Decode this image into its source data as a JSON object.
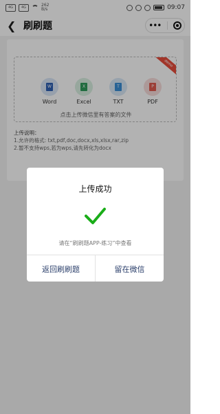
{
  "status_bar": {
    "network_speed": "262 B/s",
    "time": "09:07"
  },
  "header": {
    "title": "刷刷题"
  },
  "upload_area": {
    "file_types": [
      {
        "label": "Word",
        "icon": "word-file-icon",
        "color": "#2d5fb4",
        "bg": "#d9e6f7",
        "glyph": "W"
      },
      {
        "label": "Excel",
        "icon": "excel-file-icon",
        "color": "#2e9b5b",
        "bg": "#d8efe1",
        "glyph": "X"
      },
      {
        "label": "TXT",
        "icon": "txt-file-icon",
        "color": "#3a8ed6",
        "bg": "#d8e8f6",
        "glyph": "T"
      },
      {
        "label": "PDF",
        "icon": "pdf-file-icon",
        "color": "#e05a4e",
        "bg": "#f7dcda",
        "glyph": "P"
      }
    ],
    "hint": "点击上传微信里有答案的文件",
    "corner_badge": "demo"
  },
  "notes": {
    "title": "上传说明：",
    "lines": [
      "1.允许的格式: txt,pdf,doc,docx,xls,xlsx,rar,zip",
      "2.暂不支持wps,若为wps,请先转化为docx"
    ]
  },
  "dialog": {
    "title": "上传成功",
    "message": "请在“刷刷题APP-练习”中查看",
    "buttons": {
      "back": "返回刷刷题",
      "stay": "留在微信"
    },
    "accent": "#1aad19"
  }
}
